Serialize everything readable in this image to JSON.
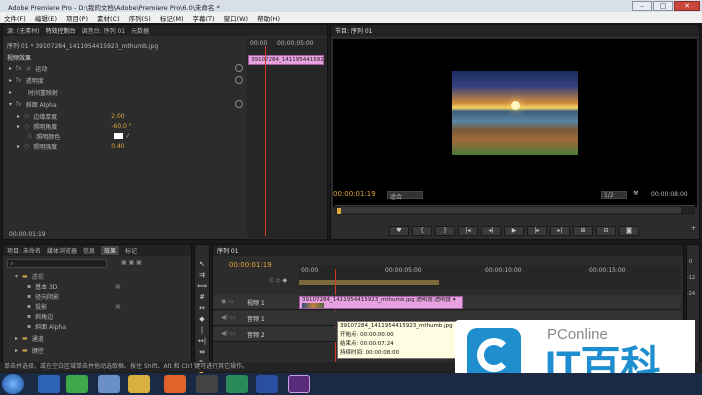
{
  "window_title": "Adobe Premiere Pro - D:\\我的文档\\Adobe\\Premiere Pro\\6.0\\未命名 *",
  "win_buttons": [
    "–",
    "□",
    "✕"
  ],
  "menu": [
    "文件(F)",
    "编辑(E)",
    "项目(P)",
    "素材(C)",
    "序列(S)",
    "标记(M)",
    "字幕(T)",
    "窗口(W)",
    "帮助(H)"
  ],
  "effect_controls": {
    "tabs": [
      "源: (无素材)",
      "特效控制台",
      "调音台: 序列 01",
      "元数据"
    ],
    "clip_header": "序列 01 * 39107284_1411954415923_mthumb.jpg",
    "section": "视频效果",
    "t_start": "00:00",
    "t_end": "00:00:05:00",
    "clip_label": "39107284_1411954415923_",
    "items": [
      "运动",
      "透明度",
      "时间重映射",
      "斜面 Alpha"
    ],
    "params": [
      {
        "label": "边缘厚度",
        "value": "2.00"
      },
      {
        "label": "照明角度",
        "value": "-60.0 °"
      },
      {
        "label": "照明颜色",
        "value": ""
      },
      {
        "label": "照明强度",
        "value": "0.40"
      }
    ],
    "timecode": "00:00:01:19"
  },
  "program": {
    "tab": "节目: 序列 01",
    "timecode": "00:00:01:19",
    "fit": "适合",
    "ratio": "1/2",
    "duration": "00:00:08:00"
  },
  "project": {
    "tabs": [
      "项目: 未命名",
      "媒体浏览器",
      "信息",
      "效果",
      "标记"
    ],
    "items": [
      "透视",
      "基本 3D",
      "径向阴影",
      "投影",
      "斜角边",
      "斜面 Alpha",
      "通道",
      "键控"
    ]
  },
  "timeline": {
    "tab": "序列 01",
    "timecode": "00:00:01:19",
    "ruler": [
      "00:00",
      "00:00:05:00",
      "00:00:10:00",
      "00:00:15:00"
    ],
    "tracks": [
      "视频 1",
      "音频 1",
      "音频 2"
    ],
    "clip_label": "39107284_1411954415923_mthumb.jpg  透明度:透明度 ▾",
    "tooltip": [
      "39107284_1411954415923_mthumb.jpg",
      "开始点: 00:00:00:00",
      "结束点: 00:00:07:24",
      "持续时间: 00:00:08:00"
    ]
  },
  "audio_meter": {
    "db_labels": [
      "0",
      "-12",
      "-24"
    ]
  },
  "status": "单击并选择，或在空白区域单击并拖动选取框。按住 Shift、Alt 和 Ctrl 键可进行其它操作。",
  "watermark": {
    "brand": "PConline",
    "text": "IT百科"
  },
  "taskbar": {
    "apps": [
      "ie",
      "360",
      "explorer",
      "media-player",
      "firefox",
      "terminal",
      "player",
      "photoshop",
      "premiere"
    ]
  }
}
